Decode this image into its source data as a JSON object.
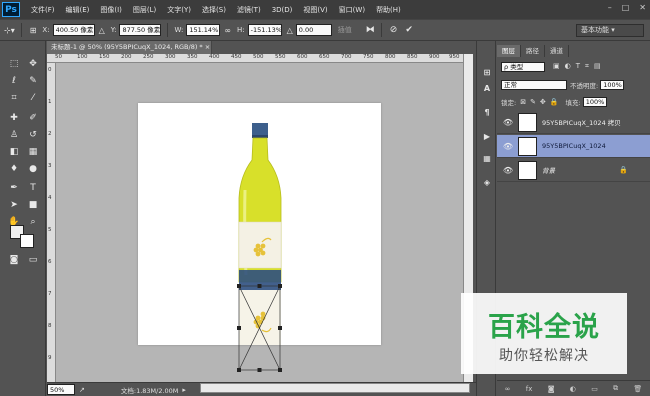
{
  "app": {
    "logo": "Ps"
  },
  "menu": [
    "文件(F)",
    "编辑(E)",
    "图像(I)",
    "图层(L)",
    "文字(Y)",
    "选择(S)",
    "滤镜(T)",
    "3D(D)",
    "视图(V)",
    "窗口(W)",
    "帮助(H)"
  ],
  "window_controls": [
    "–",
    "□",
    "✕"
  ],
  "options": {
    "x_label": "X:",
    "x_value": "400.50 像素",
    "y_label": "Y:",
    "y_value": "877.50 像素",
    "w_label": "W:",
    "w_value": "151.14%",
    "h_label": "H:",
    "h_value": "-151.13%",
    "angle_value": "0.00",
    "interp_label": "插值",
    "warp_label": "调整模式",
    "workspace": "基本功能"
  },
  "document": {
    "tab_title": "未标题-1 @ 50% (95Y5BPICuqX_1024, RGB/8) *",
    "zoom": "50%",
    "info": "文档:1.83M/2.00M",
    "ruler_h": [
      "50",
      "100",
      "150",
      "200",
      "250",
      "300",
      "350",
      "400",
      "450",
      "500",
      "550",
      "600",
      "650",
      "700",
      "750",
      "800",
      "850",
      "900",
      "950"
    ],
    "ruler_v": [
      "0",
      "1",
      "2",
      "3",
      "4",
      "5",
      "6",
      "7",
      "8",
      "9"
    ]
  },
  "layers_panel": {
    "tabs": [
      "图层",
      "路径",
      "通道"
    ],
    "filter_label": "ρ 类型",
    "blend_mode": "正常",
    "opacity_label": "不透明度:",
    "opacity_value": "100%",
    "lock_label": "锁定:",
    "fill_label": "填充:",
    "fill_value": "100%",
    "layers": [
      {
        "name": "95Y5BPICuqX_1024 拷贝",
        "selected": false
      },
      {
        "name": "95Y5BPICuqX_1024",
        "selected": true
      },
      {
        "name": "背景",
        "selected": false
      }
    ],
    "footer_icons": [
      "link-icon",
      "fx-icon",
      "mask-icon",
      "adjustment-icon",
      "folder-icon",
      "new-layer-icon",
      "trash-icon"
    ]
  },
  "watermark": {
    "main": "百科全说",
    "sub": "助你轻松解决"
  },
  "colors": {
    "accent": "#31a8ff",
    "selection": "#8c9ed2",
    "watermark_green": "#2aa34a",
    "bottle_glass": "#d8e02a",
    "bottle_cap": "#3d5f8c"
  }
}
